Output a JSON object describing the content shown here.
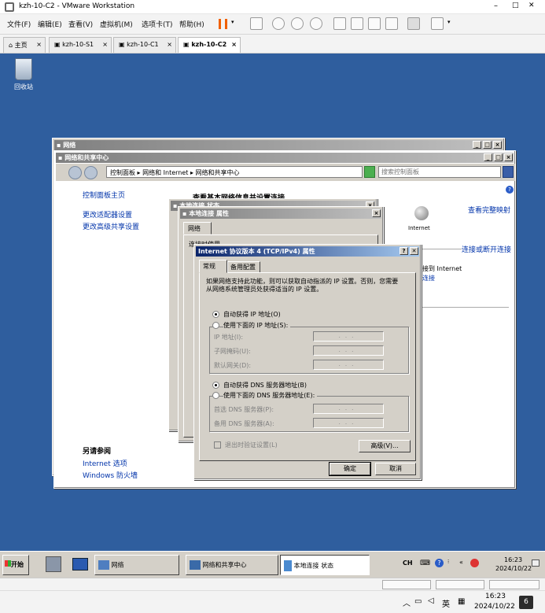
{
  "vmware": {
    "title": "kzh-10-C2 - VMware Workstation",
    "window_controls": [
      "–",
      "□",
      "✕"
    ],
    "menu": [
      "文件(F)",
      "编辑(E)",
      "查看(V)",
      "虚拟机(M)",
      "选项卡(T)",
      "帮助(H)"
    ],
    "tabs": [
      {
        "label": "主页"
      },
      {
        "label": "kzh-10-S1"
      },
      {
        "label": "kzh-10-C1"
      },
      {
        "label": "kzh-10-C2"
      }
    ],
    "tab_close": "×"
  },
  "desktop": {
    "recycle_bin": "回收站"
  },
  "network_window": {
    "title": "网络"
  },
  "nsc_window": {
    "title": "网络和共享中心",
    "breadcrumb": "控制面板 ▸ 网络和 Internet ▸ 网络和共享中心",
    "search_placeholder": "搜索控制面板",
    "sidebar": {
      "home": "控制面板主页",
      "adapter": "更改适配器设置",
      "advanced": "更改高级共享设置",
      "see_also": "另请参阅",
      "internet_options": "Internet 选项",
      "firewall": "Windows 防火墙"
    },
    "main_heading": "查看基本网络信息并设置连接",
    "full_map": "查看完整映射",
    "internet_label": "Internet",
    "connect_disconnect": "连接或断开连接",
    "connect_to_internet": "接到 Internet",
    "connection": "连接"
  },
  "status_window": {
    "title": "本地连接 状态"
  },
  "props_window": {
    "title": "本地连接 属性",
    "tab": "网络",
    "partial_label": "连接时使用"
  },
  "ipv4_dialog": {
    "title": "Internet 协议版本 4 (TCP/IPv4) 属性",
    "help": "?",
    "close": "✕",
    "tabs": [
      "常规",
      "备用配置"
    ],
    "description": "如果网络支持此功能，则可以获取自动指派的 IP 设置。否则，您需要从网络系统管理员处获得适当的 IP 设置。",
    "auto_ip": "自动获得 IP 地址(O)",
    "manual_ip": "使用下面的 IP 地址(S):",
    "ip_address": "IP 地址(I):",
    "subnet": "子网掩码(U):",
    "gateway": "默认网关(D):",
    "auto_dns": "自动获得 DNS 服务器地址(B)",
    "manual_dns": "使用下面的 DNS 服务器地址(E):",
    "preferred_dns": "首选 DNS 服务器(P):",
    "alternate_dns": "备用 DNS 服务器(A):",
    "dots": "...",
    "validate": "退出时验证设置(L)",
    "advanced": "高级(V)...",
    "ok": "确定",
    "cancel": "取消"
  },
  "taskbar": {
    "start": "开始",
    "items": [
      "网络",
      "网络和共享中心",
      "本地连接 状态"
    ],
    "ime": "CH",
    "time": "16:23",
    "date": "2024/10/22"
  },
  "host_taskbar": {
    "ime": "英",
    "time": "16:23",
    "date": "2024/10/22",
    "notif_count": "6"
  },
  "colors": {
    "desktop": "#2f5e9e",
    "title_active": "#0a246a",
    "pause": "#f06000"
  }
}
